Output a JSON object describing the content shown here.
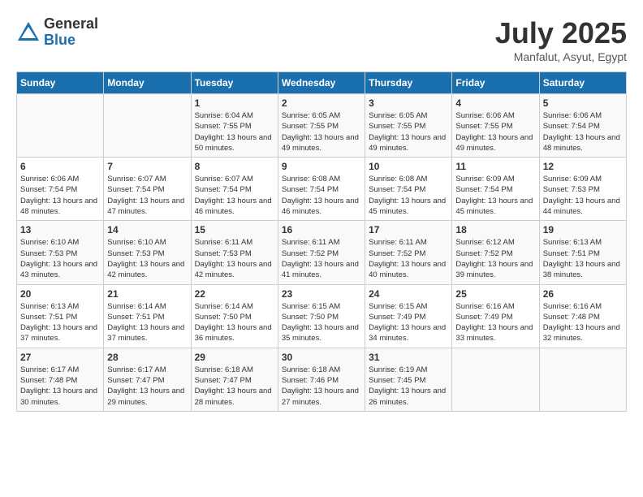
{
  "header": {
    "logo_general": "General",
    "logo_blue": "Blue",
    "month_year": "July 2025",
    "location": "Manfalut, Asyut, Egypt"
  },
  "days_of_week": [
    "Sunday",
    "Monday",
    "Tuesday",
    "Wednesday",
    "Thursday",
    "Friday",
    "Saturday"
  ],
  "weeks": [
    [
      {
        "day": "",
        "info": ""
      },
      {
        "day": "",
        "info": ""
      },
      {
        "day": "1",
        "info": "Sunrise: 6:04 AM\nSunset: 7:55 PM\nDaylight: 13 hours and 50 minutes."
      },
      {
        "day": "2",
        "info": "Sunrise: 6:05 AM\nSunset: 7:55 PM\nDaylight: 13 hours and 49 minutes."
      },
      {
        "day": "3",
        "info": "Sunrise: 6:05 AM\nSunset: 7:55 PM\nDaylight: 13 hours and 49 minutes."
      },
      {
        "day": "4",
        "info": "Sunrise: 6:06 AM\nSunset: 7:55 PM\nDaylight: 13 hours and 49 minutes."
      },
      {
        "day": "5",
        "info": "Sunrise: 6:06 AM\nSunset: 7:54 PM\nDaylight: 13 hours and 48 minutes."
      }
    ],
    [
      {
        "day": "6",
        "info": "Sunrise: 6:06 AM\nSunset: 7:54 PM\nDaylight: 13 hours and 48 minutes."
      },
      {
        "day": "7",
        "info": "Sunrise: 6:07 AM\nSunset: 7:54 PM\nDaylight: 13 hours and 47 minutes."
      },
      {
        "day": "8",
        "info": "Sunrise: 6:07 AM\nSunset: 7:54 PM\nDaylight: 13 hours and 46 minutes."
      },
      {
        "day": "9",
        "info": "Sunrise: 6:08 AM\nSunset: 7:54 PM\nDaylight: 13 hours and 46 minutes."
      },
      {
        "day": "10",
        "info": "Sunrise: 6:08 AM\nSunset: 7:54 PM\nDaylight: 13 hours and 45 minutes."
      },
      {
        "day": "11",
        "info": "Sunrise: 6:09 AM\nSunset: 7:54 PM\nDaylight: 13 hours and 45 minutes."
      },
      {
        "day": "12",
        "info": "Sunrise: 6:09 AM\nSunset: 7:53 PM\nDaylight: 13 hours and 44 minutes."
      }
    ],
    [
      {
        "day": "13",
        "info": "Sunrise: 6:10 AM\nSunset: 7:53 PM\nDaylight: 13 hours and 43 minutes."
      },
      {
        "day": "14",
        "info": "Sunrise: 6:10 AM\nSunset: 7:53 PM\nDaylight: 13 hours and 42 minutes."
      },
      {
        "day": "15",
        "info": "Sunrise: 6:11 AM\nSunset: 7:53 PM\nDaylight: 13 hours and 42 minutes."
      },
      {
        "day": "16",
        "info": "Sunrise: 6:11 AM\nSunset: 7:52 PM\nDaylight: 13 hours and 41 minutes."
      },
      {
        "day": "17",
        "info": "Sunrise: 6:11 AM\nSunset: 7:52 PM\nDaylight: 13 hours and 40 minutes."
      },
      {
        "day": "18",
        "info": "Sunrise: 6:12 AM\nSunset: 7:52 PM\nDaylight: 13 hours and 39 minutes."
      },
      {
        "day": "19",
        "info": "Sunrise: 6:13 AM\nSunset: 7:51 PM\nDaylight: 13 hours and 38 minutes."
      }
    ],
    [
      {
        "day": "20",
        "info": "Sunrise: 6:13 AM\nSunset: 7:51 PM\nDaylight: 13 hours and 37 minutes."
      },
      {
        "day": "21",
        "info": "Sunrise: 6:14 AM\nSunset: 7:51 PM\nDaylight: 13 hours and 37 minutes."
      },
      {
        "day": "22",
        "info": "Sunrise: 6:14 AM\nSunset: 7:50 PM\nDaylight: 13 hours and 36 minutes."
      },
      {
        "day": "23",
        "info": "Sunrise: 6:15 AM\nSunset: 7:50 PM\nDaylight: 13 hours and 35 minutes."
      },
      {
        "day": "24",
        "info": "Sunrise: 6:15 AM\nSunset: 7:49 PM\nDaylight: 13 hours and 34 minutes."
      },
      {
        "day": "25",
        "info": "Sunrise: 6:16 AM\nSunset: 7:49 PM\nDaylight: 13 hours and 33 minutes."
      },
      {
        "day": "26",
        "info": "Sunrise: 6:16 AM\nSunset: 7:48 PM\nDaylight: 13 hours and 32 minutes."
      }
    ],
    [
      {
        "day": "27",
        "info": "Sunrise: 6:17 AM\nSunset: 7:48 PM\nDaylight: 13 hours and 30 minutes."
      },
      {
        "day": "28",
        "info": "Sunrise: 6:17 AM\nSunset: 7:47 PM\nDaylight: 13 hours and 29 minutes."
      },
      {
        "day": "29",
        "info": "Sunrise: 6:18 AM\nSunset: 7:47 PM\nDaylight: 13 hours and 28 minutes."
      },
      {
        "day": "30",
        "info": "Sunrise: 6:18 AM\nSunset: 7:46 PM\nDaylight: 13 hours and 27 minutes."
      },
      {
        "day": "31",
        "info": "Sunrise: 6:19 AM\nSunset: 7:45 PM\nDaylight: 13 hours and 26 minutes."
      },
      {
        "day": "",
        "info": ""
      },
      {
        "day": "",
        "info": ""
      }
    ]
  ]
}
